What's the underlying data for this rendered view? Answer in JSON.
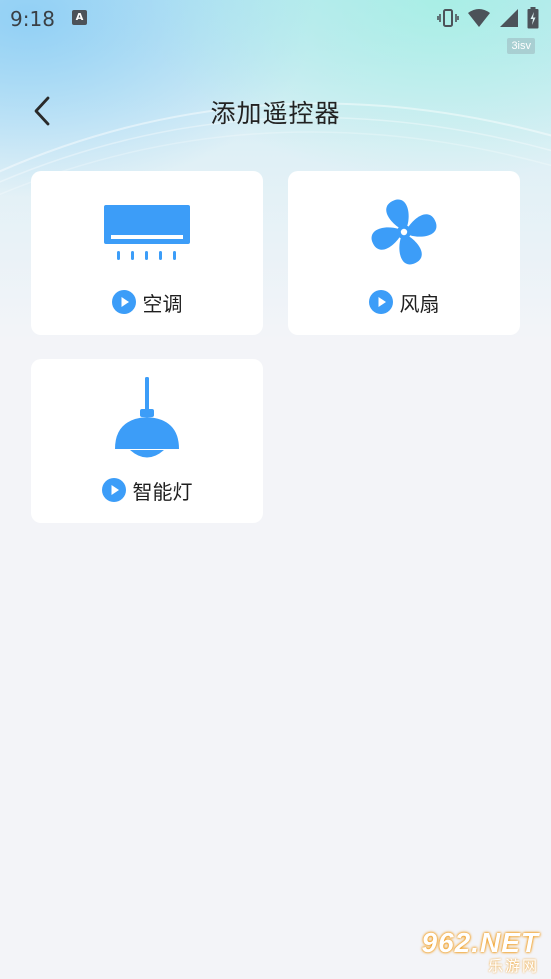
{
  "status_bar": {
    "time": "9:18",
    "notification_icon": "A",
    "icons": [
      "vibrate-icon",
      "wifi-icon",
      "signal-icon",
      "battery-charging-icon"
    ]
  },
  "badge": "3isv",
  "header": {
    "title": "添加遥控器",
    "back_icon": "chevron-left-icon"
  },
  "cards": [
    {
      "label": "空调",
      "icon": "air-conditioner-icon"
    },
    {
      "label": "风扇",
      "icon": "fan-icon"
    },
    {
      "label": "智能灯",
      "icon": "pendant-lamp-icon"
    }
  ],
  "colors": {
    "accent": "#3c9df8",
    "card_bg": "#ffffff",
    "page_bg": "#f3f4f8",
    "title_text": "#222222"
  },
  "watermark": {
    "brand": "962.NET",
    "cn": "乐游网"
  }
}
